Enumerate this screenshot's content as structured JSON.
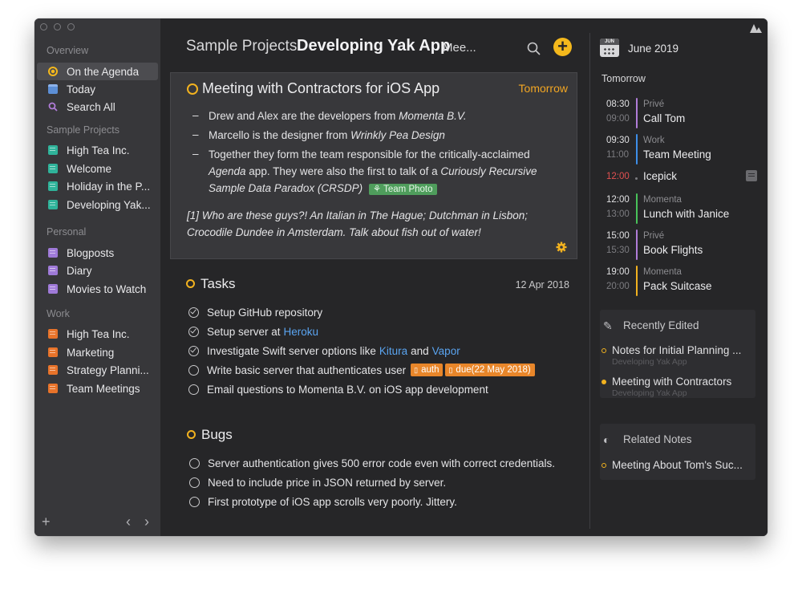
{
  "colors": {
    "accent_yellow": "#f4b81c",
    "link_blue": "#5aa4f0",
    "tag_orange": "#e8862a",
    "tag_green": "#4f9d5c",
    "sidebar_bg": "#37373a",
    "main_bg": "#262628"
  },
  "sidebar": {
    "overview_label": "Overview",
    "overview_items": [
      {
        "label": "On the Agenda",
        "icon": "agenda-icon",
        "color": "#f4b81c"
      },
      {
        "label": "Today",
        "icon": "today-icon",
        "color": "#5c8fd6"
      },
      {
        "label": "Search All",
        "icon": "search-icon",
        "color": "#b07cd8"
      }
    ],
    "groups": [
      {
        "label": "Sample Projects",
        "color": "#2fb39a",
        "items": [
          "High Tea Inc.",
          "Welcome",
          "Holiday in the P...",
          "Developing Yak..."
        ]
      },
      {
        "label": "Personal",
        "color": "#9f7ad8",
        "items": [
          "Blogposts",
          "Diary",
          "Movies to Watch"
        ]
      },
      {
        "label": "Work",
        "color": "#e8732a",
        "items": [
          "High Tea Inc.",
          "Marketing",
          "Strategy Planni...",
          "Team Meetings"
        ]
      }
    ],
    "add_icon": "+",
    "back_icon": "‹",
    "forward_icon": "›"
  },
  "header": {
    "project": "Sample Projects",
    "document": "Developing Yak App",
    "more": "Mee...",
    "search_icon": "search-icon",
    "add_icon": "+"
  },
  "meeting": {
    "title": "Meeting with Contractors for iOS App",
    "date": "Tomorrow",
    "bullets": [
      {
        "prefix": "Drew and Alex are the developers from ",
        "em": "Momenta B.V."
      },
      {
        "prefix": "Marcello is the designer from ",
        "em": "Wrinkly Pea Design"
      }
    ],
    "bullet3": {
      "a": "Together they form the team responsible for the critically-acclaimed ",
      "b": "Agenda",
      "c": " app. They were also the first to talk of a ",
      "d": "Curiously Recursive Sample Data Paradox (CRSDP)",
      "tag": "Team Photo"
    },
    "footnote": "[1] Who are these guys?! An Italian in The Hague; Dutchman in Lisbon; Crocodile Dundee in Amsterdam. Talk about fish out of water!",
    "gear_icon": "gear-icon"
  },
  "tasks": {
    "title": "Tasks",
    "date": "12 Apr 2018",
    "t1": "Setup GitHub repository",
    "t2_a": "Setup server at",
    "t2_link": "Heroku",
    "t3_a": "Investigate Swift server options like",
    "t3_link1": "Kitura",
    "t3_mid": "and",
    "t3_link2": "Vapor",
    "t4": "Write basic server that authenticates user",
    "t4_tag1": "auth",
    "t4_tag2": "due(22 May 2018)",
    "t5": "Email questions to Momenta B.V. on iOS app development"
  },
  "bugs": {
    "title": "Bugs",
    "items": [
      "Server authentication gives 500 error code even with correct credentials.",
      "Need to include price in JSON returned by server.",
      "First prototype of iOS app scrolls very poorly. Jittery."
    ]
  },
  "agenda": {
    "cal_month_short": "JUN",
    "month": "June 2019",
    "section": "Tomorrow",
    "events": [
      {
        "start": "08:30",
        "end": "09:00",
        "calendar": "Privé",
        "title": "Call Tom",
        "color": "#b07cd8"
      },
      {
        "start": "09:30",
        "end": "11:00",
        "calendar": "Work",
        "title": "Team Meeting",
        "color": "#3d8ee8"
      },
      {
        "start": "12:00",
        "end": "",
        "calendar": "",
        "title": "Icepick",
        "color": "#e05050"
      },
      {
        "start": "12:00",
        "end": "13:00",
        "calendar": "Momenta",
        "title": "Lunch with Janice",
        "color": "#48c25a"
      },
      {
        "start": "15:00",
        "end": "15:30",
        "calendar": "Privé",
        "title": "Book Flights",
        "color": "#b07cd8"
      },
      {
        "start": "19:00",
        "end": "20:00",
        "calendar": "Momenta",
        "title": "Pack Suitcase",
        "color": "#f2b21f"
      }
    ],
    "recently_edited": {
      "title": "Recently Edited",
      "items": [
        {
          "title": "Notes for Initial Planning ...",
          "sub": "Developing Yak App"
        },
        {
          "title": "Meeting with Contractors",
          "sub": "Developing Yak App"
        }
      ]
    },
    "related": {
      "title": "Related Notes",
      "items": [
        {
          "title": "Meeting About Tom's Suc..."
        }
      ]
    }
  }
}
